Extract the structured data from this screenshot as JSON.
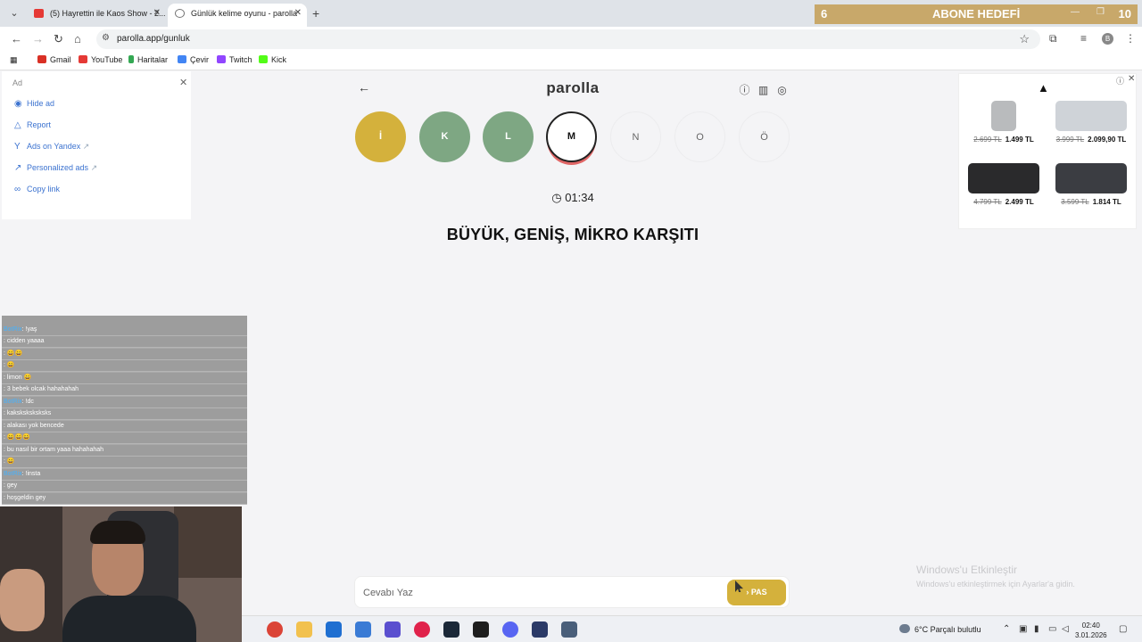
{
  "browser": {
    "tabs": [
      {
        "title": "(5) Hayrettin ile Kaos Show - 2...",
        "favicon_color": "#e53935"
      },
      {
        "title": "Günlük kelime oyunu - parolla",
        "favicon_color": "#777777"
      }
    ],
    "url": "parolla.app/gunluk",
    "bookmarks": [
      {
        "label": "Gmail",
        "color": "#d93025"
      },
      {
        "label": "YouTube",
        "color": "#e53935"
      },
      {
        "label": "Haritalar",
        "color": "#34a853"
      },
      {
        "label": "Çevir",
        "color": "#4285f4"
      },
      {
        "label": "Twitch",
        "color": "#9146ff"
      },
      {
        "label": "Kick",
        "color": "#53fc18"
      }
    ],
    "profile_initial": "B"
  },
  "overlay": {
    "abone_left": "6",
    "abone_title": "ABONE HEDEFİ",
    "abone_right": "10"
  },
  "left_ad": {
    "label": "Ad",
    "items": [
      {
        "icon": "eye-off-icon",
        "label": "Hide ad"
      },
      {
        "icon": "warning-icon",
        "label": "Report"
      },
      {
        "icon": "yandex-icon",
        "label": "Ads on Yandex"
      },
      {
        "icon": "arrow-icon",
        "label": "Personalized ads"
      },
      {
        "icon": "link-icon",
        "label": "Copy link"
      }
    ]
  },
  "game": {
    "brand": "parolla",
    "letters": [
      {
        "letter": "İ",
        "state": "yellow"
      },
      {
        "letter": "K",
        "state": "green"
      },
      {
        "letter": "L",
        "state": "green"
      },
      {
        "letter": "M",
        "state": "active"
      },
      {
        "letter": "N",
        "state": "empty"
      },
      {
        "letter": "O",
        "state": "empty"
      },
      {
        "letter": "Ö",
        "state": "empty"
      }
    ],
    "timer": "01:34",
    "question": "BÜYÜK, GENİŞ, MİKRO KARŞITI",
    "answer_placeholder": "Cevabı Yaz",
    "pas_label": "PAS",
    "colors": {
      "yellow": "#d4b13c",
      "green": "#7ea783",
      "active_ring": "#e06666"
    }
  },
  "right_ad": {
    "products": [
      {
        "old": "2.699 TL",
        "new": "1.499 TL",
        "img_color": "#b9bbbd"
      },
      {
        "old": "3.999 TL",
        "new": "2.099,90 TL",
        "img_color": "#cfd3d8"
      },
      {
        "old": "4.799 TL",
        "new": "2.499 TL",
        "img_color": "#2a2a2c"
      },
      {
        "old": "3.599 TL",
        "new": "1.814 TL",
        "img_color": "#3b3d42"
      }
    ]
  },
  "activation": {
    "line1": "Windows'u Etkinleştir",
    "line2": "Windows'u etkinleştirmek için Ayarlar'a gidin."
  },
  "chat": [
    {
      "user": "",
      "msg": "",
      "style": "normal"
    },
    {
      "user": "BotRix",
      "msg": ": !yaş",
      "style": "bot"
    },
    {
      "user": "",
      "msg": ": cidden yaaaa",
      "style": "normal"
    },
    {
      "user": "",
      "msg": ": 😄😄",
      "style": "normal"
    },
    {
      "user": "",
      "msg": ": 😄",
      "style": "normal"
    },
    {
      "user": "",
      "msg": ": limon 😄",
      "style": "normal"
    },
    {
      "user": "",
      "msg": ": 3 bebek olcak hahahahah",
      "style": "normal"
    },
    {
      "user": "BotRix",
      "msg": ": !dc",
      "style": "bot"
    },
    {
      "user": "",
      "msg": ": kaksksksksksks",
      "style": "normal"
    },
    {
      "user": "",
      "msg": ": alakası yok bencede",
      "style": "normal"
    },
    {
      "user": "",
      "msg": ": 😄😄😄",
      "style": "normal"
    },
    {
      "user": "",
      "msg": ": bu nasıl bir ortam yaaa hahahahah",
      "style": "normal"
    },
    {
      "user": "",
      "msg": ": 😄",
      "style": "normal"
    },
    {
      "user": "BotRix",
      "msg": ": !insta",
      "style": "bot"
    },
    {
      "user": "",
      "msg": ": gey",
      "style": "red"
    },
    {
      "user": "",
      "msg": ": hoşgeldin gey",
      "style": "gold"
    }
  ],
  "taskbar": {
    "weather": "6°C  Parçalı bulutlu",
    "time": "02:40",
    "date": "3.01.2026"
  }
}
